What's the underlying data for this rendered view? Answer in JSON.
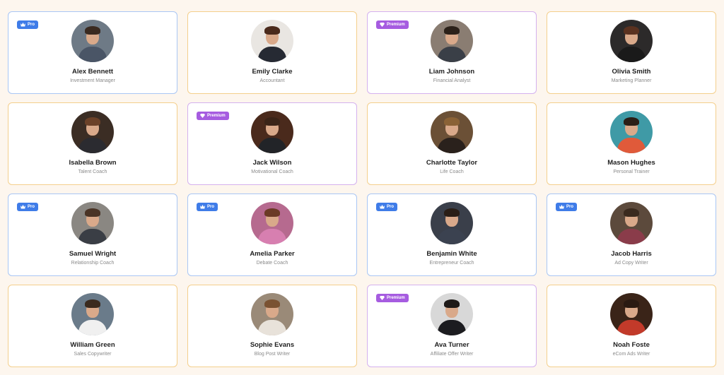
{
  "badges": {
    "pro": "Pro",
    "premium": "Premium"
  },
  "colors": {
    "background": "#fdf6ee",
    "border_free": "#f4cf8c",
    "border_pro": "#a9c6f4",
    "border_premium": "#d4b1ee",
    "badge_pro": "#3f7ce8",
    "badge_premium": "#a65ce0"
  },
  "cards": [
    {
      "name": "Alex Bennett",
      "role": "Investment Manager",
      "tier": "pro",
      "photo_bg": "#6e7a86",
      "hair": "#3a2a20",
      "outfit": "#4a5566"
    },
    {
      "name": "Emily Clarke",
      "role": "Accountant",
      "tier": "none",
      "photo_bg": "#e9e6e2",
      "hair": "#4a2a1c",
      "outfit": "#262a33"
    },
    {
      "name": "Liam Johnson",
      "role": "Financial Analyst",
      "tier": "premium",
      "photo_bg": "#8a7d72",
      "hair": "#2b2119",
      "outfit": "#3a3f47"
    },
    {
      "name": "Olivia Smith",
      "role": "Marketing Planner",
      "tier": "none",
      "photo_bg": "#2c2a2a",
      "hair": "#5a3220",
      "outfit": "#1a1a1a"
    },
    {
      "name": "Isabella Brown",
      "role": "Talent Coach",
      "tier": "none",
      "photo_bg": "#3b2d24",
      "hair": "#6b4128",
      "outfit": "#2b2b30"
    },
    {
      "name": "Jack Wilson",
      "role": "Motivational Coach",
      "tier": "premium",
      "photo_bg": "#4a2a1c",
      "hair": "#3a2418",
      "outfit": "#222428"
    },
    {
      "name": "Charlotte Taylor",
      "role": "Life Coach",
      "tier": "none",
      "photo_bg": "#6b5036",
      "hair": "#8a6236",
      "outfit": "#2a211c"
    },
    {
      "name": "Mason Hughes",
      "role": "Personal Trainer",
      "tier": "none",
      "photo_bg": "#3f9aa6",
      "hair": "#2a1e16",
      "outfit": "#e05a3a"
    },
    {
      "name": "Samuel Wright",
      "role": "Relationship Coach",
      "tier": "pro",
      "photo_bg": "#8a8782",
      "hair": "#4a3426",
      "outfit": "#3a3e45"
    },
    {
      "name": "Amelia Parker",
      "role": "Debate Coach",
      "tier": "pro",
      "photo_bg": "#b66a8f",
      "hair": "#6b3a26",
      "outfit": "#d77fb0"
    },
    {
      "name": "Benjamin White",
      "role": "Entrepreneur Coach",
      "tier": "pro",
      "photo_bg": "#3a3f4a",
      "hair": "#2a1e16",
      "outfit": "#3b4250"
    },
    {
      "name": "Jacob Harris",
      "role": "Ad Copy Writer",
      "tier": "pro",
      "photo_bg": "#5c4a3c",
      "hair": "#3a2a1e",
      "outfit": "#8a3c4a"
    },
    {
      "name": "William Green",
      "role": "Sales Copywriter",
      "tier": "none",
      "photo_bg": "#6a7b8a",
      "hair": "#3a2a1e",
      "outfit": "#f0f0f0"
    },
    {
      "name": "Sophie Evans",
      "role": "Blog Post Writer",
      "tier": "none",
      "photo_bg": "#9a8a78",
      "hair": "#7a5232",
      "outfit": "#e8e2da"
    },
    {
      "name": "Ava Turner",
      "role": "Affiliate Offer Writer",
      "tier": "premium",
      "photo_bg": "#d8d8d8",
      "hair": "#1e1a18",
      "outfit": "#1c1c20"
    },
    {
      "name": "Noah Foste",
      "role": "eCom Ads Writer",
      "tier": "none",
      "photo_bg": "#3a2418",
      "hair": "#2a1a12",
      "outfit": "#c23a2a"
    }
  ]
}
